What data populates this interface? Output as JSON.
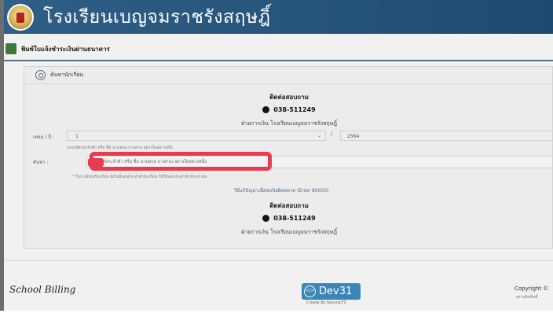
{
  "header": {
    "school_name": "โรงเรียนเบญจมราชรังสฤษฎิ์"
  },
  "subbar": {
    "title": "พิมพ์ใบแจ้งชำระเงินผ่านธนาคาร"
  },
  "panel": {
    "title": "ค้นหานักเรียน",
    "contact_top": {
      "title": "ติดต่อสอบถาม",
      "phone": "038-511249",
      "department": "ฝ่ายการเงิน โรงเรียนเบญจมราชรังสฤษฎิ์"
    },
    "form": {
      "term_label": "เทอม / ปี :",
      "term_value": "1",
      "slash": "/",
      "year_value": "2564",
      "term_hint": "ระบุรหัสประจำตัว หรือ ชื่อ นามสกุล บางส่วน อย่างใดอย่างหนึ่ง",
      "search_label": "ค้นหา :",
      "search_placeholder": "รหัสประจำตัว หรือ ชื่อ นามสกุล บางส่วน อย่างใดอย่างหนึ่ง",
      "warning": "* ในกรณีนักเรียนใหม่ ยังไม่มีเลขประจำตัวนักเรียน ให้ใช้เลขประจำตัวประชาชน",
      "help_link": "วิธีแก้ปัญหาเมื่อพบข้อผิดพลาด (Error 80003)"
    },
    "contact_bottom": {
      "title": "ติดต่อสอบถาม",
      "phone": "038-511249",
      "department": "ฝ่ายการเงิน โรงเรียนเบญจมราชรังสฤษฎิ์"
    }
  },
  "footer": {
    "brand": "School Billing",
    "dev_label": "Dev31",
    "dev_sub": "Create By NounsLFC",
    "copyright": "Copyright ©",
    "copyright_sub": "สงวนลิขสิทธิ์"
  },
  "colors": {
    "header_blue": "#245178",
    "badge_blue": "#3c86b7",
    "highlight_red": "#e43d4f"
  },
  "icons": {
    "logo": "school-emblem-icon",
    "search": "search-icon",
    "phone": "phone-icon",
    "dev": "code-icon"
  }
}
